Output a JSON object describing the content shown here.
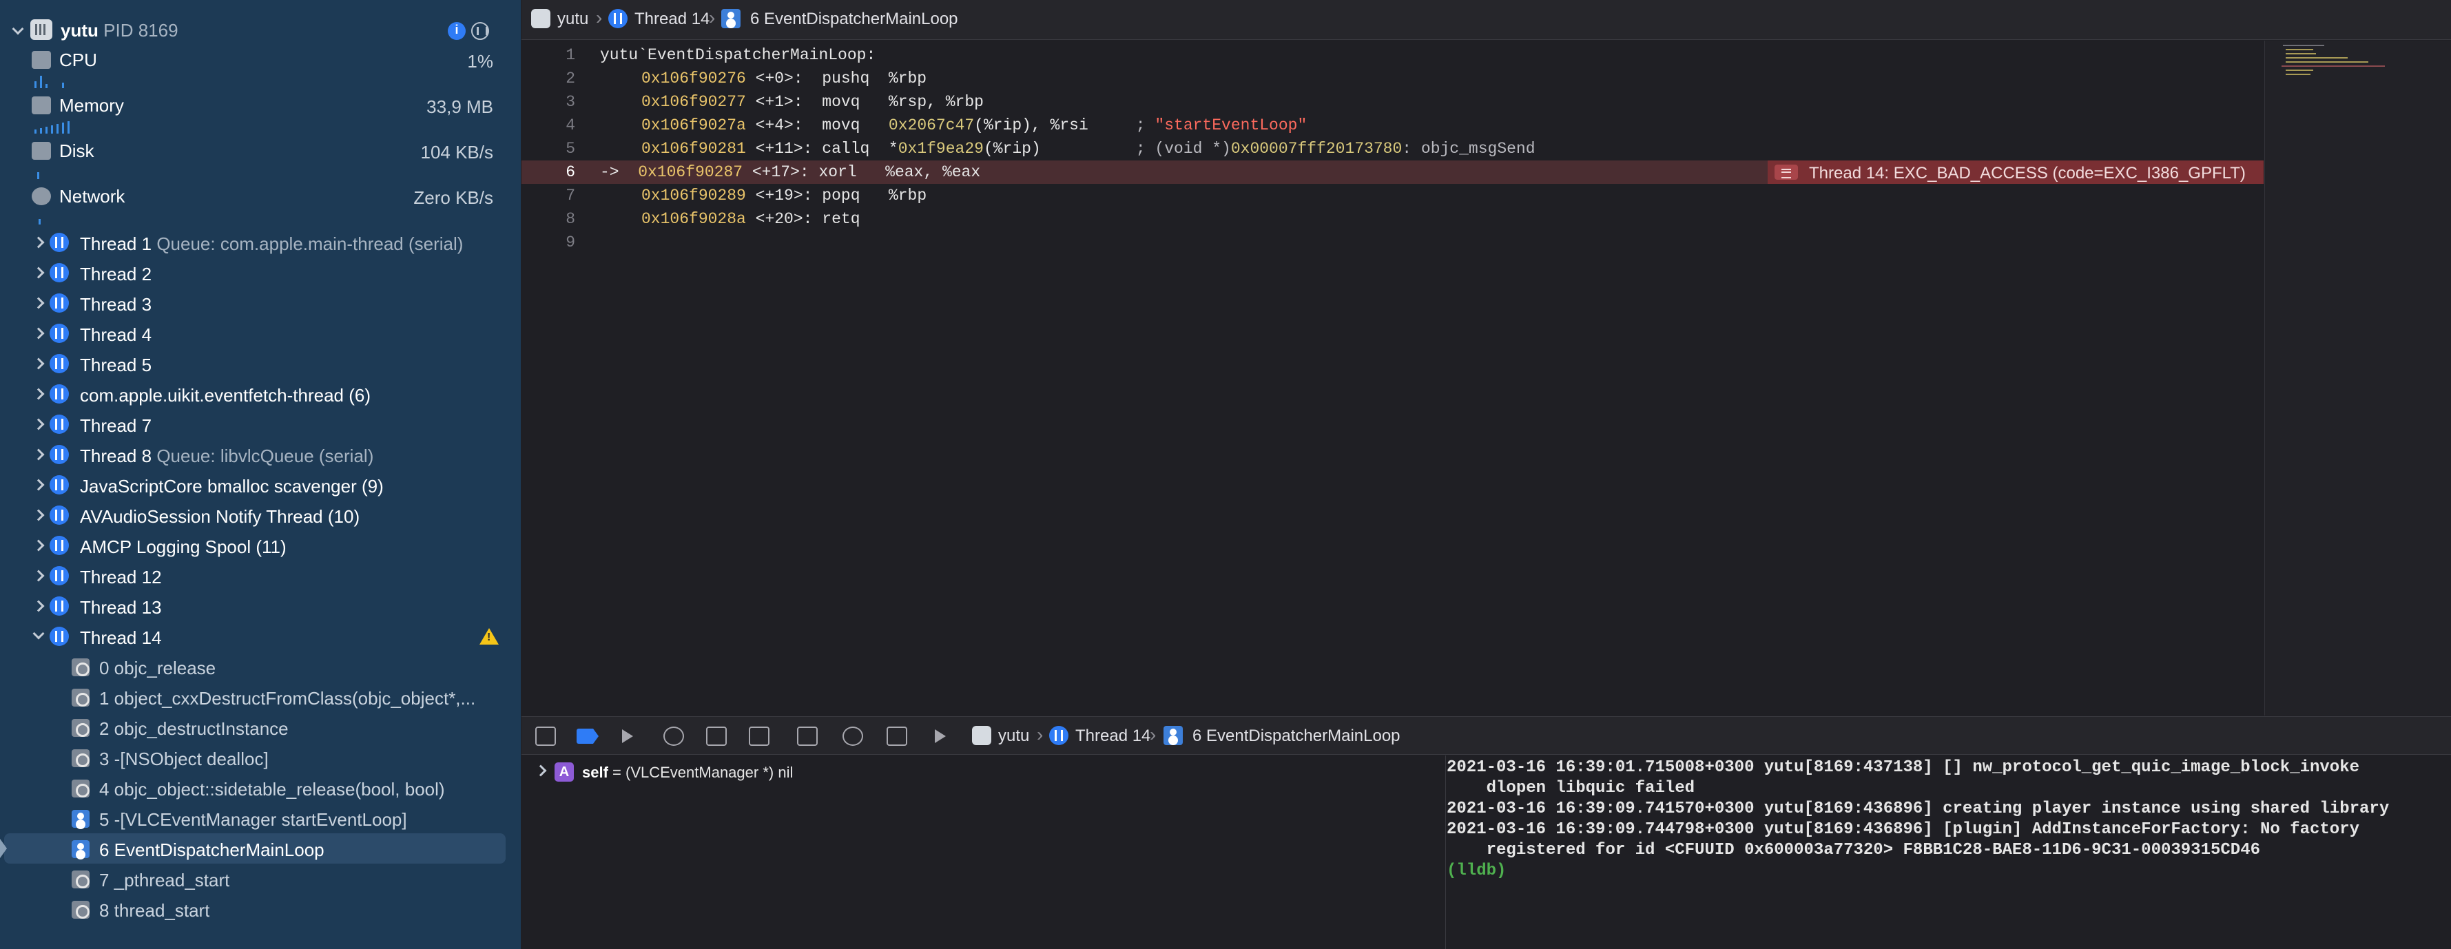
{
  "process": {
    "name": "yutu",
    "pid_label": "PID 8169"
  },
  "gauges": [
    {
      "label": "CPU",
      "value": "1%"
    },
    {
      "label": "Memory",
      "value": "33,9 MB"
    },
    {
      "label": "Disk",
      "value": "104 KB/s"
    },
    {
      "label": "Network",
      "value": "Zero KB/s"
    }
  ],
  "threads": [
    {
      "name": "Thread 1",
      "queue": "Queue: com.apple.main-thread (serial)"
    },
    {
      "name": "Thread 2",
      "queue": ""
    },
    {
      "name": "Thread 3",
      "queue": ""
    },
    {
      "name": "Thread 4",
      "queue": ""
    },
    {
      "name": "Thread 5",
      "queue": ""
    },
    {
      "name": "com.apple.uikit.eventfetch-thread (6)",
      "queue": ""
    },
    {
      "name": "Thread 7",
      "queue": ""
    },
    {
      "name": "Thread 8",
      "queue": "Queue: libvlcQueue (serial)"
    },
    {
      "name": "JavaScriptCore bmalloc scavenger (9)",
      "queue": ""
    },
    {
      "name": "AVAudioSession Notify Thread (10)",
      "queue": ""
    },
    {
      "name": "AMCP Logging Spool (11)",
      "queue": ""
    },
    {
      "name": "Thread 12",
      "queue": ""
    },
    {
      "name": "Thread 13",
      "queue": ""
    },
    {
      "name": "Thread 14",
      "queue": ""
    }
  ],
  "frames": [
    {
      "label": "0 objc_release",
      "kind": "sys"
    },
    {
      "label": "1 object_cxxDestructFromClass(objc_object*,...",
      "kind": "sys"
    },
    {
      "label": "2 objc_destructInstance",
      "kind": "sys"
    },
    {
      "label": "3 -[NSObject dealloc]",
      "kind": "sys"
    },
    {
      "label": "4 objc_object::sidetable_release(bool, bool)",
      "kind": "sys"
    },
    {
      "label": "5 -[VLCEventManager startEventLoop]",
      "kind": "user"
    },
    {
      "label": "6 EventDispatcherMainLoop",
      "kind": "user"
    },
    {
      "label": "7 _pthread_start",
      "kind": "sys"
    },
    {
      "label": "8 thread_start",
      "kind": "sys"
    }
  ],
  "breadcrumb": {
    "app": "yutu",
    "thread": "Thread 14",
    "frame": "6 EventDispatcherMainLoop"
  },
  "code": {
    "line_numbers": [
      "1",
      "2",
      "3",
      "4",
      "5",
      "6",
      "7",
      "8",
      "9"
    ],
    "header": "yutu`EventDispatcherMainLoop:",
    "lines": [
      {
        "addr": "0x106f90276",
        "off": "<+0>:",
        "ins": "pushq",
        "ops": "%rbp",
        "tail": ""
      },
      {
        "addr": "0x106f90277",
        "off": "<+1>:",
        "ins": "movq",
        "ops": "%rsp, %rbp",
        "tail": ""
      },
      {
        "addr": "0x106f9027a",
        "off": "<+4>:",
        "ins": "movq",
        "ops_hex": "0x2067c47",
        "ops": "(%rip), %rsi",
        "cmt": ";",
        "str": "\"startEventLoop\""
      },
      {
        "addr": "0x106f90281",
        "off": "<+11>:",
        "ins": "callq",
        "ops_pre": "*",
        "ops_hex": "0x1f9ea29",
        "ops": "(%rip)",
        "cmt": "; (void *)",
        "cmt_hex": "0x00007fff20173780",
        "cmt_tail": ": objc_msgSend"
      },
      {
        "addr": "0x106f90287",
        "off": "<+17>:",
        "ins": "xorl",
        "ops": "%eax, %eax",
        "arrow": "->"
      },
      {
        "addr": "0x106f90289",
        "off": "<+19>:",
        "ins": "popq",
        "ops": "%rbp",
        "tail": ""
      },
      {
        "addr": "0x106f9028a",
        "off": "<+20>:",
        "ins": "retq",
        "ops": "",
        "tail": ""
      }
    ],
    "error": "Thread 14: EXC_BAD_ACCESS (code=EXC_I386_GPFLT)"
  },
  "debug_breadcrumb": {
    "app": "yutu",
    "thread": "Thread 14",
    "frame": "6 EventDispatcherMainLoop"
  },
  "variables": [
    {
      "badge": "A",
      "name": "self",
      "value": "= (VLCEventManager *) nil"
    }
  ],
  "console": [
    "2021-03-16 16:39:01.715008+0300 yutu[8169:437138] [] nw_protocol_get_quic_image_block_invoke",
    "    dlopen libquic failed",
    "2021-03-16 16:39:09.741570+0300 yutu[8169:436896] creating player instance using shared library",
    "2021-03-16 16:39:09.744798+0300 yutu[8169:436896] [plugin] AddInstanceForFactory: No factory",
    "    registered for id <CFUUID 0x600003a77320> F8BB1C28-BAE8-11D6-9C31-00039315CD46"
  ],
  "console_prompt": "(lldb)",
  "colors": {
    "sidebar": "#1d3a55",
    "accent": "#2f7cf6",
    "error_line": "#4a2d31",
    "address": "#e9c46a",
    "string": "#fc6a5d"
  }
}
